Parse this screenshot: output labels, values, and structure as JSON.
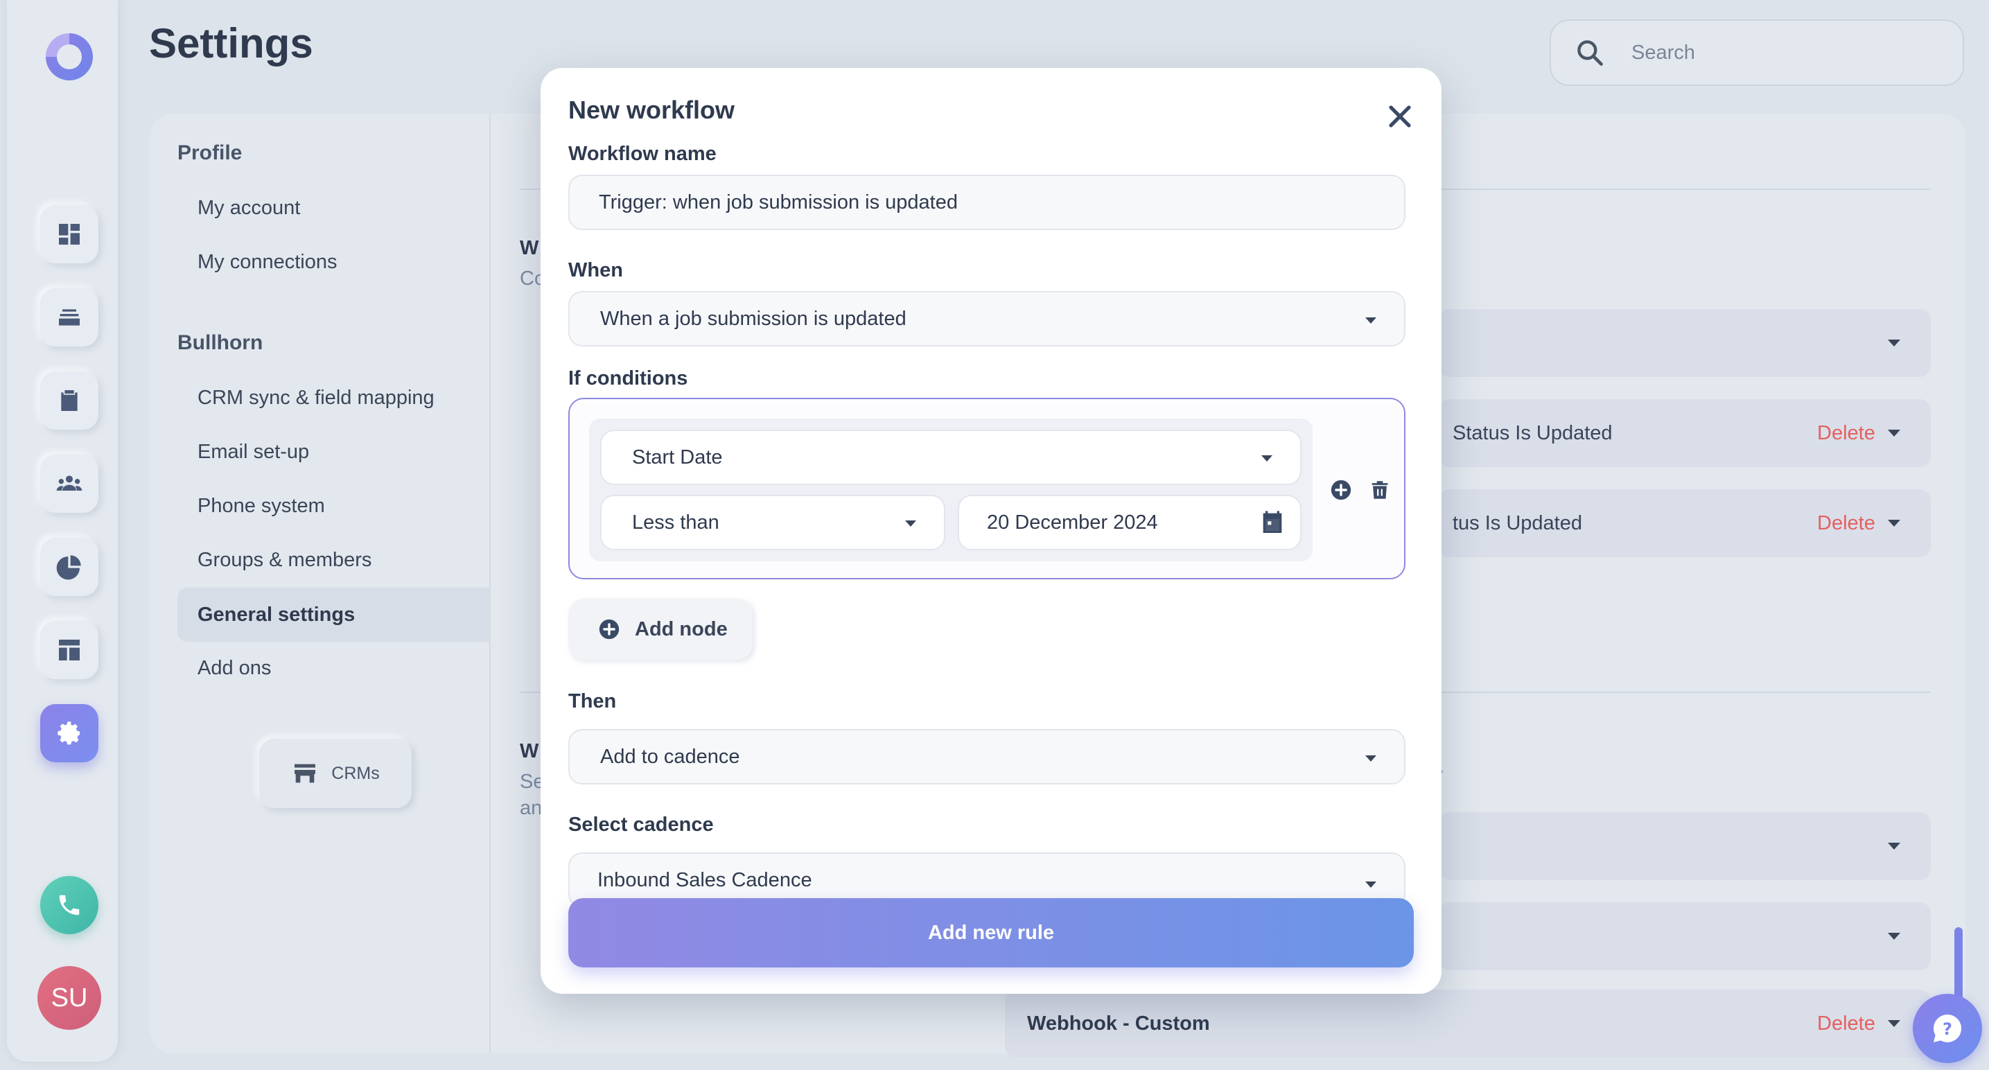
{
  "page": {
    "title": "Settings"
  },
  "search": {
    "placeholder": "Search"
  },
  "rail": {
    "icons": [
      "dashboard-icon",
      "inbox-icon",
      "clipboard-icon",
      "team-icon",
      "pie-chart-icon",
      "layout-icon",
      "gear-icon"
    ],
    "active": "gear-icon",
    "avatar_initials": "SU"
  },
  "subnav": {
    "groups": [
      {
        "label": "Profile",
        "items": [
          "My account",
          "My connections"
        ]
      },
      {
        "label": "Bullhorn",
        "items": [
          "CRM sync & field mapping",
          "Email set-up",
          "Phone system",
          "Groups & members",
          "General settings",
          "Add ons"
        ]
      }
    ],
    "active_item": "General settings",
    "crm_button": "CRMs"
  },
  "background": {
    "fragments": [
      "W",
      "Co",
      "W",
      "Se",
      "an",
      "."
    ],
    "rows": [
      {
        "label": "",
        "delete": ""
      },
      {
        "label": "Status Is Updated",
        "delete": "Delete"
      },
      {
        "label": "tus Is Updated",
        "delete": "Delete"
      },
      {
        "label": "",
        "delete": ""
      },
      {
        "label": "",
        "delete": ""
      },
      {
        "label": "Webhook - Custom",
        "delete": "Delete"
      }
    ]
  },
  "modal": {
    "title": "New workflow",
    "workflow_name_label": "Workflow name",
    "workflow_name_value": "Trigger: when job submission is updated",
    "when_label": "When",
    "when_value": "When a job submission is updated",
    "if_label": "If conditions",
    "condition": {
      "field": "Start Date",
      "operator": "Less than",
      "value": "20 December 2024"
    },
    "add_node": "Add node",
    "then_label": "Then",
    "then_value": "Add to cadence",
    "cadence_label": "Select cadence",
    "cadence_value": "Inbound Sales Cadence",
    "submit": "Add new rule"
  },
  "colors": {
    "accent_start": "#9189e4",
    "accent_end": "#6b95e6",
    "delete": "#e5605f",
    "phone": "#3fb6a8",
    "avatar": "#e36f82"
  }
}
